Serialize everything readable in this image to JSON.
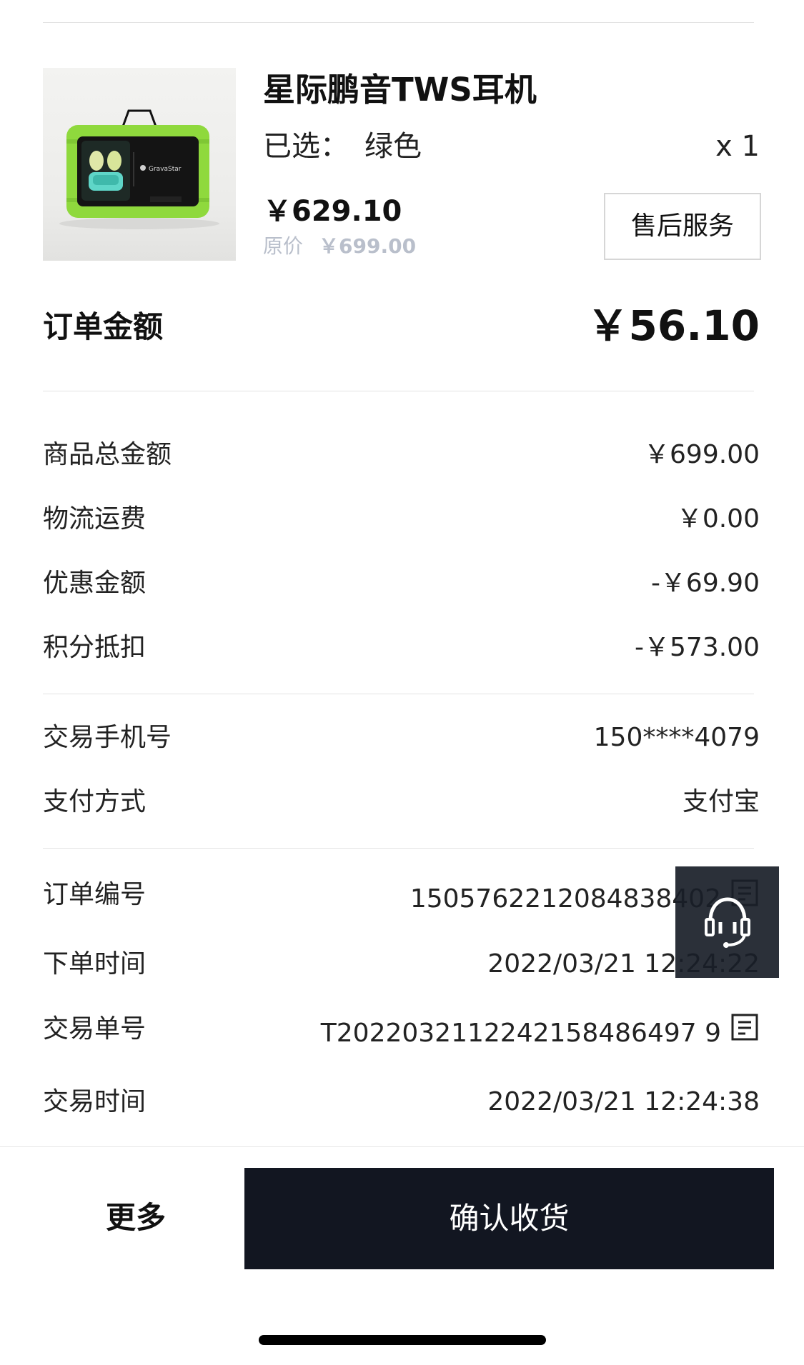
{
  "product": {
    "title": "星际鹏音TWS耳机",
    "variant_label": "已选：",
    "variant_value": "绿色",
    "quantity": "x 1",
    "price": "￥629.10",
    "original_price_label": "原价",
    "original_price": "￥699.00",
    "image_brand_text": "GravaStar",
    "after_sales_label": "售后服务"
  },
  "order_amount": {
    "label": "订单金额",
    "value": "￥56.10"
  },
  "breakdown": [
    {
      "label": "商品总金额",
      "value": "￥699.00"
    },
    {
      "label": "物流运费",
      "value": "￥0.00"
    },
    {
      "label": "优惠金额",
      "value": "-￥69.90"
    },
    {
      "label": "积分抵扣",
      "value": "-￥573.00"
    }
  ],
  "payment": [
    {
      "label": "交易手机号",
      "value": "150****4079"
    },
    {
      "label": "支付方式",
      "value": "支付宝"
    }
  ],
  "order_info": [
    {
      "label": "订单编号",
      "value": "1505762212084838402"
    },
    {
      "label": "下单时间",
      "value": "2022/03/21 12:24:22"
    },
    {
      "label": "交易单号",
      "value": "T2022032112242158486497 9"
    },
    {
      "label": "交易时间",
      "value": "2022/03/21 12:24:38"
    }
  ],
  "bottom": {
    "more_label": "更多",
    "confirm_label": "确认收货"
  },
  "icons": {
    "copy": "copy-icon",
    "support": "headset-icon"
  },
  "colors": {
    "primary_button": "#121621",
    "muted_text": "#b9bfcb",
    "product_green": "#8fd93d"
  }
}
